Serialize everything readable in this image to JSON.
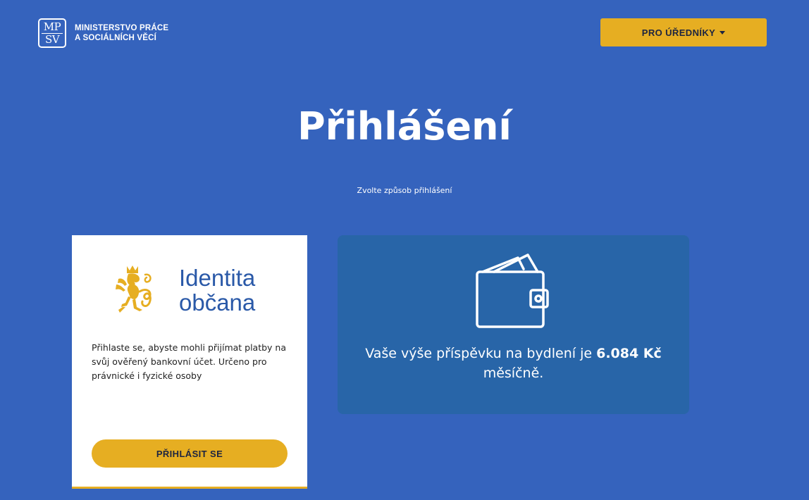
{
  "header": {
    "logo": {
      "mark_top": "MP",
      "mark_bottom": "SV",
      "line1": "MINISTERSTVO PRÁCE",
      "line2": "A SOCIÁLNÍCH VĚCÍ"
    },
    "officials_button": {
      "label": "PRO ÚŘEDNÍKY",
      "icon": "caret-down-icon"
    }
  },
  "main": {
    "title": "Přihlášení",
    "subtitle": "Zvolte způsob přihlášení"
  },
  "login_card": {
    "identity_line1": "Identita",
    "identity_line2": "občana",
    "emblem_icon": "czech-lion-emblem-icon",
    "description": "Přihlaste se, abyste mohli přijímat platby na svůj ověřený bankovní účet. Určeno pro právnické i fyzické osoby",
    "button_label": "PŘIHLÁSIT SE"
  },
  "info_card": {
    "icon": "wallet-icon",
    "text_before": "Vaše výše příspěvku na bydlení je ",
    "amount": "6.084 Kč",
    "text_after": "měsíčně."
  },
  "colors": {
    "background": "#3563bd",
    "accent_yellow": "#e6ae22",
    "info_card": "#2865a8",
    "identity_text": "#2a59a8"
  }
}
